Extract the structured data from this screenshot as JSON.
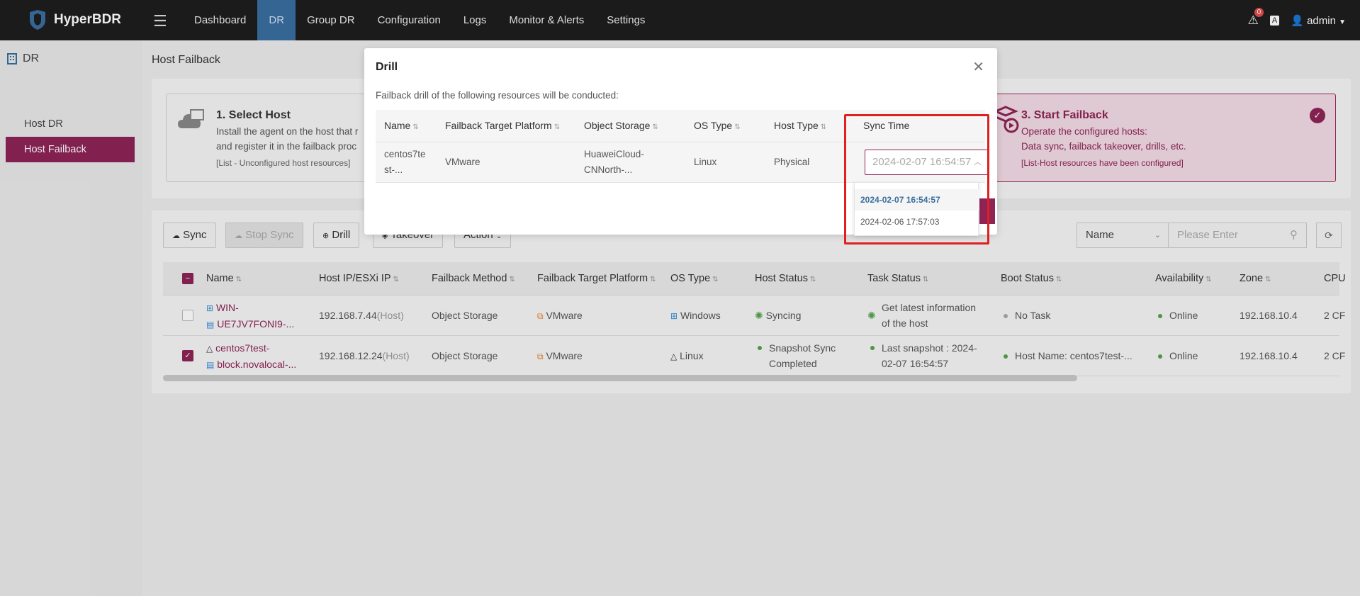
{
  "app": {
    "name": "HyperBDR",
    "brand_color": "#8e2456",
    "nav_active_color": "#3a6e9f"
  },
  "nav": {
    "items": [
      {
        "label": "Dashboard"
      },
      {
        "label": "DR"
      },
      {
        "label": "Group DR"
      },
      {
        "label": "Configuration"
      },
      {
        "label": "Logs"
      },
      {
        "label": "Monitor & Alerts"
      },
      {
        "label": "Settings"
      }
    ]
  },
  "top_right": {
    "alert_count": "0",
    "translate_label": "A",
    "user": "admin"
  },
  "sidebar": {
    "header": "DR",
    "items": [
      {
        "label": "Host DR"
      },
      {
        "label": "Host Failback"
      }
    ]
  },
  "page": {
    "title": "Host Failback"
  },
  "steps": [
    {
      "title": "1. Select Host",
      "line1": "Install the agent on the host that r",
      "line2": "and register it in the failback proc",
      "note": "[List - Unconfigured host resources]"
    },
    {
      "title": "3. Start Failback",
      "line1": "Operate the configured hosts:",
      "line2": "Data sync, failback takeover, drills, etc.",
      "note": "[List-Host resources have been configured]"
    }
  ],
  "toolbar": {
    "sync": "Sync",
    "stop_sync": "Stop Sync",
    "drill": "Drill",
    "takeover": "Takeover",
    "action": "Action",
    "search_field": "Name",
    "search_placeholder": "Please Enter"
  },
  "table": {
    "headers": [
      "Name",
      "Host IP/ESXi IP",
      "Failback Method",
      "Failback Target Platform",
      "OS Type",
      "Host Status",
      "Task Status",
      "Boot Status",
      "Availability",
      "Zone",
      "CPU"
    ],
    "rows": [
      {
        "name1": "WIN-",
        "name2": "UE7JV7FONI9-...",
        "ip": "192.168.7.44",
        "ip_tag": "(Host)",
        "method": "Object Storage",
        "platform": "VMware",
        "os": "Windows",
        "host_status": "Syncing",
        "task1": "Get latest information",
        "task2": "of the host",
        "boot": "No Task",
        "availability": "Online",
        "zone": "192.168.10.4",
        "cpu": "2 CF"
      },
      {
        "name1": "centos7test-",
        "name2": "block.novalocal-...",
        "ip": "192.168.12.24",
        "ip_tag": "(Host)",
        "method": "Object Storage",
        "platform": "VMware",
        "os": "Linux",
        "host_status1": "Snapshot Sync",
        "host_status2": "Completed",
        "task1": "Last snapshot : 2024-",
        "task2": "02-07 16:54:57",
        "boot": "Host Name: centos7test-...",
        "availability": "Online",
        "zone": "192.168.10.4",
        "cpu": "2 CF"
      }
    ]
  },
  "modal": {
    "title": "Drill",
    "description": "Failback drill of the following resources will be conducted:",
    "headers": [
      "Name",
      "Failback Target Platform",
      "Object Storage",
      "OS Type",
      "Host Type",
      "Sync Time"
    ],
    "row": {
      "name1": "centos7te",
      "name2": "st-...",
      "platform": "VMware",
      "storage1": "HuaweiCloud-",
      "storage2": "CNNorth-...",
      "os": "Linux",
      "host_type": "Physical",
      "sync_time": "2024-02-07 16:54:57"
    },
    "sync_options": [
      "2024-02-07 16:54:57",
      "2024-02-06 17:57:03"
    ]
  }
}
